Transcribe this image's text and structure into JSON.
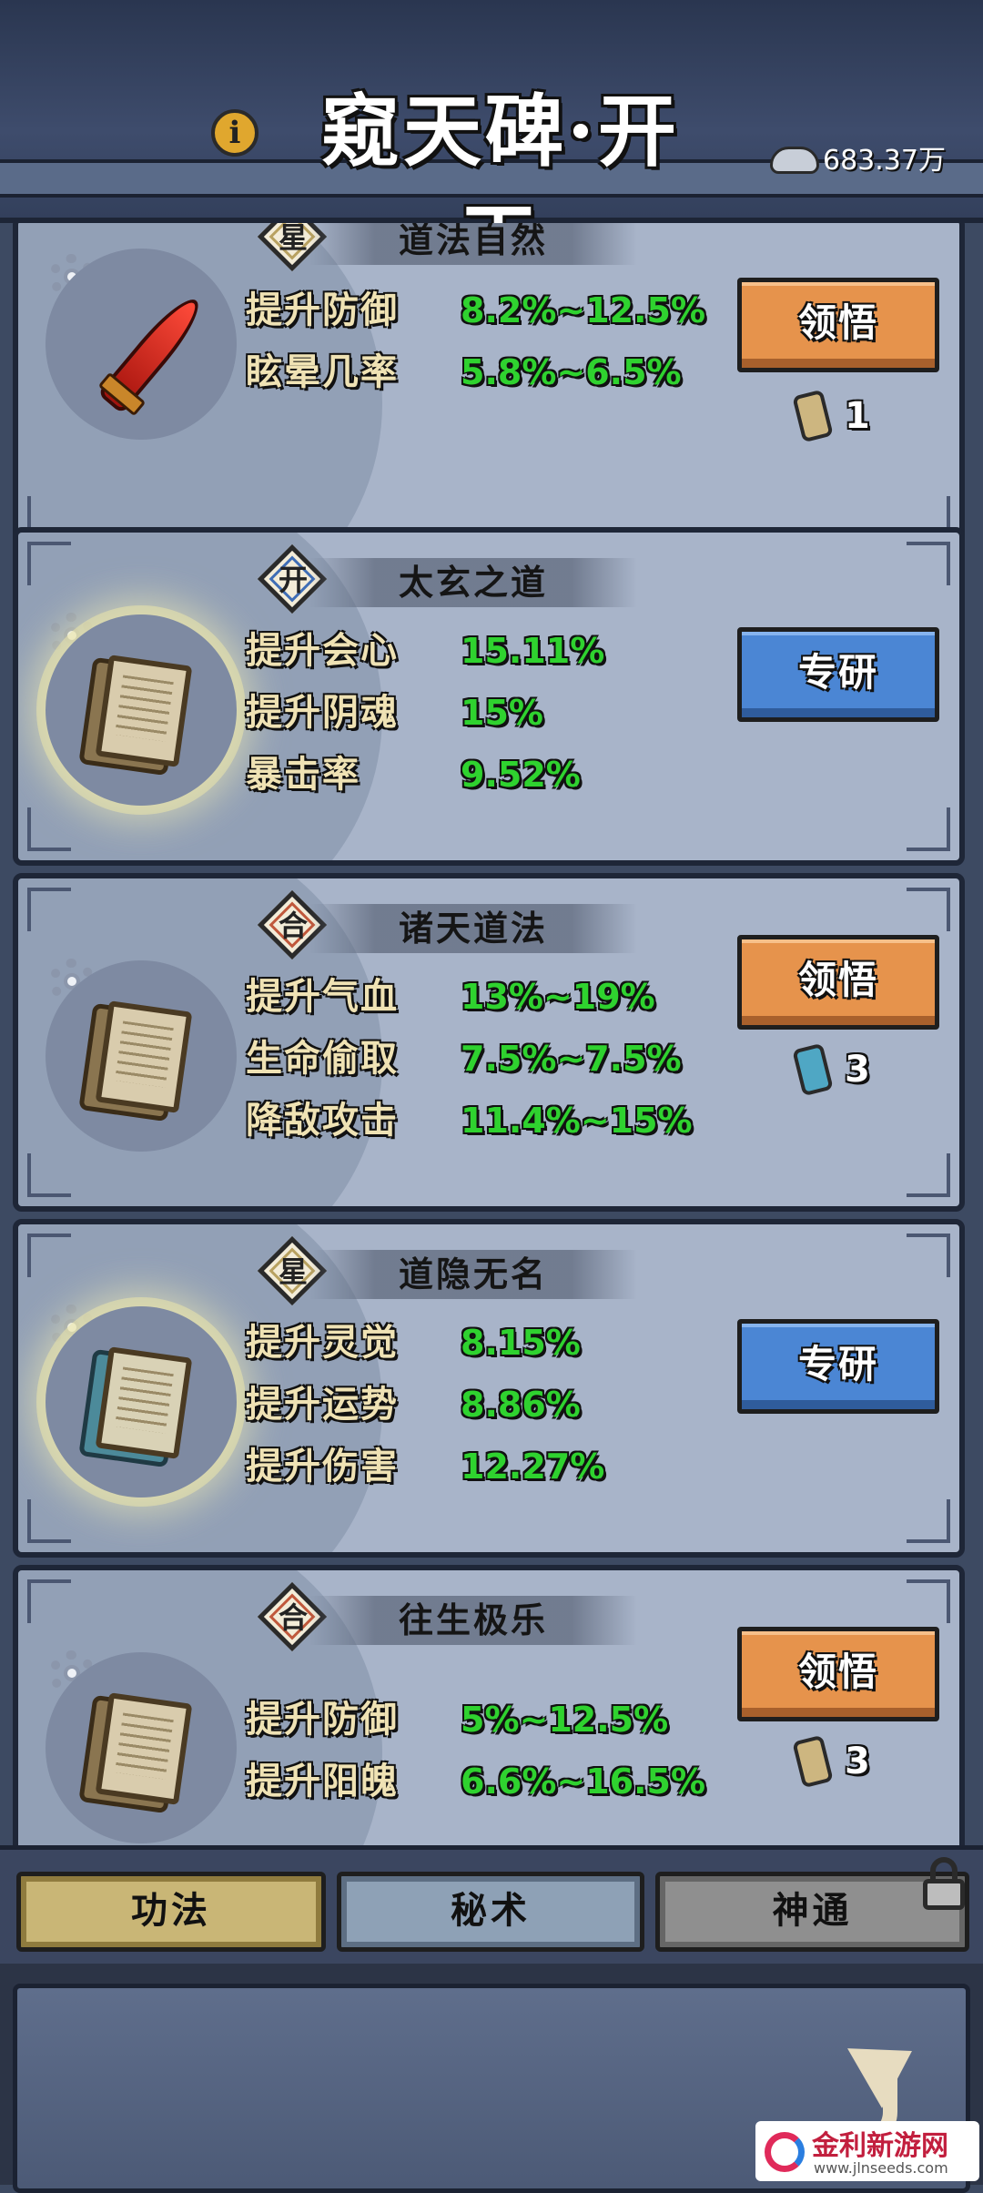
{
  "header": {
    "title": "窥天碑·开天",
    "info_icon": "info-icon",
    "currency": {
      "icon": "silver-ingot-icon",
      "amount": "683.37万"
    }
  },
  "cards": [
    {
      "badge": "星",
      "badge_color": "#b8a160",
      "name": "道法自然",
      "item_icon": "red-sword-icon",
      "stats": [
        {
          "label": "提升防御",
          "value": "8.2%~12.5%"
        },
        {
          "label": "眩晕几率",
          "value": "5.8%~6.5%"
        }
      ],
      "action": "领悟",
      "action_style": "orange",
      "cost": {
        "icon": "scroll-icon",
        "count": "1"
      }
    },
    {
      "badge": "开",
      "badge_color": "#3f6db5",
      "name": "太玄之道",
      "item_icon": "scroll-icon",
      "stats": [
        {
          "label": "提升会心",
          "value": "15.11%"
        },
        {
          "label": "提升阴魂",
          "value": "15%"
        },
        {
          "label": "暴击率",
          "value": "9.52%"
        }
      ],
      "action": "专研",
      "action_style": "blue"
    },
    {
      "badge": "合",
      "badge_color": "#c0583b",
      "name": "诸天道法",
      "item_icon": "scroll-icon",
      "stats": [
        {
          "label": "提升气血",
          "value": "13%~19%"
        },
        {
          "label": "生命偷取",
          "value": "7.5%~7.5%"
        },
        {
          "label": "降敌攻击",
          "value": "11.4%~15%"
        }
      ],
      "action": "领悟",
      "action_style": "orange",
      "cost": {
        "icon": "blue-scroll-icon",
        "count": "3"
      }
    },
    {
      "badge": "星",
      "badge_color": "#b8a160",
      "name": "道隐无名",
      "item_icon": "blue-scroll-icon",
      "stats": [
        {
          "label": "提升灵觉",
          "value": "8.15%"
        },
        {
          "label": "提升运势",
          "value": "8.86%"
        },
        {
          "label": "提升伤害",
          "value": "12.27%"
        }
      ],
      "action": "专研",
      "action_style": "blue"
    },
    {
      "badge": "合",
      "badge_color": "#c0583b",
      "name": "往生极乐",
      "item_icon": "scroll-icon",
      "stats": [
        {
          "label": "提升防御",
          "value": "5%~12.5%"
        },
        {
          "label": "提升阳魄",
          "value": "6.6%~16.5%"
        }
      ],
      "action": "领悟",
      "action_style": "orange",
      "cost": {
        "icon": "scroll-icon",
        "count": "3"
      }
    }
  ],
  "tabs": [
    {
      "label": "功法",
      "state": "active"
    },
    {
      "label": "秘术",
      "state": "normal"
    },
    {
      "label": "神通",
      "state": "locked"
    }
  ],
  "bottom": {
    "back_icon": "back-arrow-icon"
  },
  "watermark": {
    "title": "金利新游网",
    "url": "www.jlnseeds.com"
  }
}
